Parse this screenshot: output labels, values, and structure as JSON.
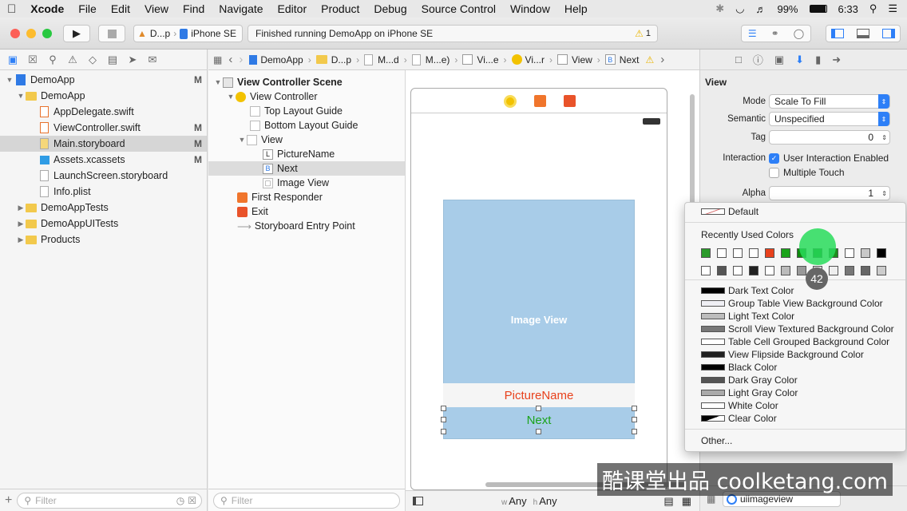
{
  "menubar": {
    "app": "Xcode",
    "items": [
      "File",
      "Edit",
      "View",
      "Find",
      "Navigate",
      "Editor",
      "Product",
      "Debug",
      "Source Control",
      "Window",
      "Help"
    ],
    "battery": "99%",
    "time": "6:33"
  },
  "toolbar": {
    "scheme_short": "D...p",
    "device": "iPhone SE",
    "activity_text": "Finished running DemoApp on iPhone SE",
    "warning_count": "1"
  },
  "navigator": {
    "rows": [
      {
        "label": "DemoApp",
        "status": "M"
      },
      {
        "label": "DemoApp",
        "status": ""
      },
      {
        "label": "AppDelegate.swift",
        "status": ""
      },
      {
        "label": "ViewController.swift",
        "status": "M"
      },
      {
        "label": "Main.storyboard",
        "status": "M"
      },
      {
        "label": "Assets.xcassets",
        "status": "M"
      },
      {
        "label": "LaunchScreen.storyboard",
        "status": ""
      },
      {
        "label": "Info.plist",
        "status": ""
      },
      {
        "label": "DemoAppTests",
        "status": ""
      },
      {
        "label": "DemoAppUITests",
        "status": ""
      },
      {
        "label": "Products",
        "status": ""
      }
    ],
    "filter_placeholder": "Filter"
  },
  "jumpbar": {
    "items": [
      "DemoApp",
      "D...p",
      "M...d",
      "M...e)",
      "Vi...e",
      "Vi...r",
      "View",
      "Next"
    ]
  },
  "outline": {
    "rows": [
      "View Controller Scene",
      "View Controller",
      "Top Layout Guide",
      "Bottom Layout Guide",
      "View",
      "PictureName",
      "Next",
      "Image View",
      "First Responder",
      "Exit",
      "Storyboard Entry Point"
    ],
    "icon_letters": {
      "label": "L",
      "button": "B"
    },
    "filter_placeholder": "Filter"
  },
  "canvas": {
    "image_view_label": "Image View",
    "label_text": "PictureName",
    "button_text": "Next",
    "size_w_prefix": "w",
    "size_w": "Any",
    "size_h_prefix": "h",
    "size_h": "Any"
  },
  "inspector": {
    "section_title": "View",
    "mode_label": "Mode",
    "mode_value": "Scale To Fill",
    "semantic_label": "Semantic",
    "semantic_value": "Unspecified",
    "tag_label": "Tag",
    "tag_value": "0",
    "interaction_label": "Interaction",
    "user_interaction": "User Interaction Enabled",
    "multiple_touch": "Multiple Touch",
    "alpha_label": "Alpha",
    "alpha_value": "1",
    "search_value": "uiimageview"
  },
  "color_menu": {
    "default_label": "Default",
    "recent_heading": "Recently Used Colors",
    "recent_row1": [
      "#2a9a2a",
      "#ffffff",
      "#ffffff",
      "#ffffff",
      "#e8411c",
      "#1aa31a",
      "#0f8a0f",
      "#0e7a0e",
      "#1e8f1e",
      "#ffffff",
      "#c8c8c8",
      "#000000"
    ],
    "recent_row2": [
      "#ffffff",
      "#555555",
      "#ffffff",
      "#222222",
      "#ffffff",
      "#bbbbbb",
      "#999999",
      "#dddddd",
      "#eeeeee",
      "#777777",
      "#666666",
      "#cccccc"
    ],
    "named": [
      {
        "label": "Dark Text Color",
        "color": "#000000"
      },
      {
        "label": "Group Table View Background Color",
        "color": "#efeff4"
      },
      {
        "label": "Light Text Color",
        "color": "#bdbdbd"
      },
      {
        "label": "Scroll View Textured Background Color",
        "color": "#777777"
      },
      {
        "label": "Table Cell Grouped Background Color",
        "color": "#ffffff"
      },
      {
        "label": "View Flipside Background Color",
        "color": "#202020"
      },
      {
        "label": "Black Color",
        "color": "#000000"
      },
      {
        "label": "Dark Gray Color",
        "color": "#555555"
      },
      {
        "label": "Light Gray Color",
        "color": "#aaaaaa"
      },
      {
        "label": "White Color",
        "color": "#ffffff"
      },
      {
        "label": "Clear Color",
        "color": "transparent"
      }
    ],
    "other_label": "Other..."
  },
  "overlay": {
    "click_count": "42",
    "watermark": "酷课堂出品 coolketang.com"
  },
  "colors": {
    "label_red": "#e8411c",
    "button_green": "#1aa31a",
    "accent_blue": "#2d7ff7"
  }
}
